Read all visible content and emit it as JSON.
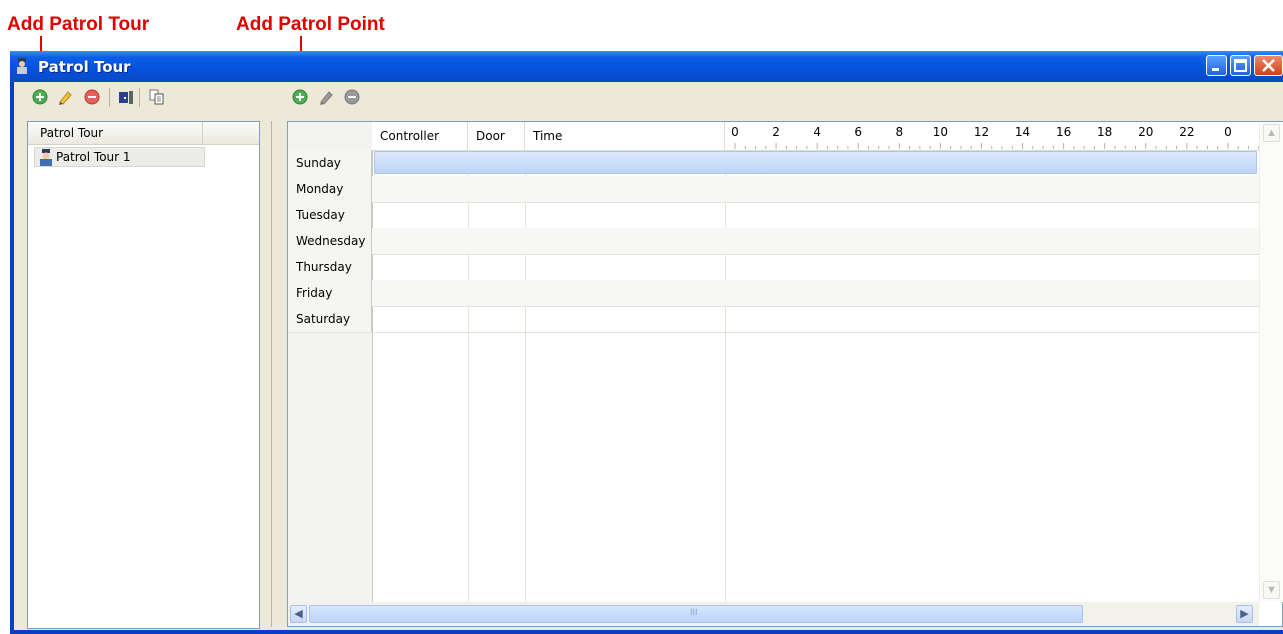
{
  "annotations": {
    "add_patrol_tour": "Add Patrol Tour",
    "add_patrol_point": "Add Patrol Point",
    "color": "#e00000"
  },
  "window": {
    "title": "Patrol Tour",
    "icon": "patrol-guard-icon"
  },
  "tour_toolbar": {
    "icons": [
      "add-icon",
      "edit-pencil-icon",
      "delete-icon",
      "door-icon",
      "copy-icon"
    ]
  },
  "point_toolbar": {
    "icons": [
      "add-icon",
      "edit-pencil-icon",
      "delete-icon"
    ]
  },
  "tour_list": {
    "header": "Patrol Tour",
    "items": [
      {
        "label": "Patrol Tour 1",
        "icon": "patrol-guard-icon"
      }
    ]
  },
  "schedule": {
    "columns": [
      "Controller",
      "Door",
      "Time"
    ],
    "hour_ticks": [
      "0",
      "2",
      "4",
      "6",
      "8",
      "10",
      "12",
      "14",
      "16",
      "18",
      "20",
      "22",
      "0"
    ],
    "days": [
      "Sunday",
      "Monday",
      "Tuesday",
      "Wednesday",
      "Thursday",
      "Friday",
      "Saturday"
    ],
    "selected_day": "Sunday",
    "scrollbar_mid_glyph": "III"
  },
  "colors": {
    "title_bar": "#0550dc",
    "selected_row": "#c9dcf6",
    "panel_bg": "#ece9d8"
  }
}
